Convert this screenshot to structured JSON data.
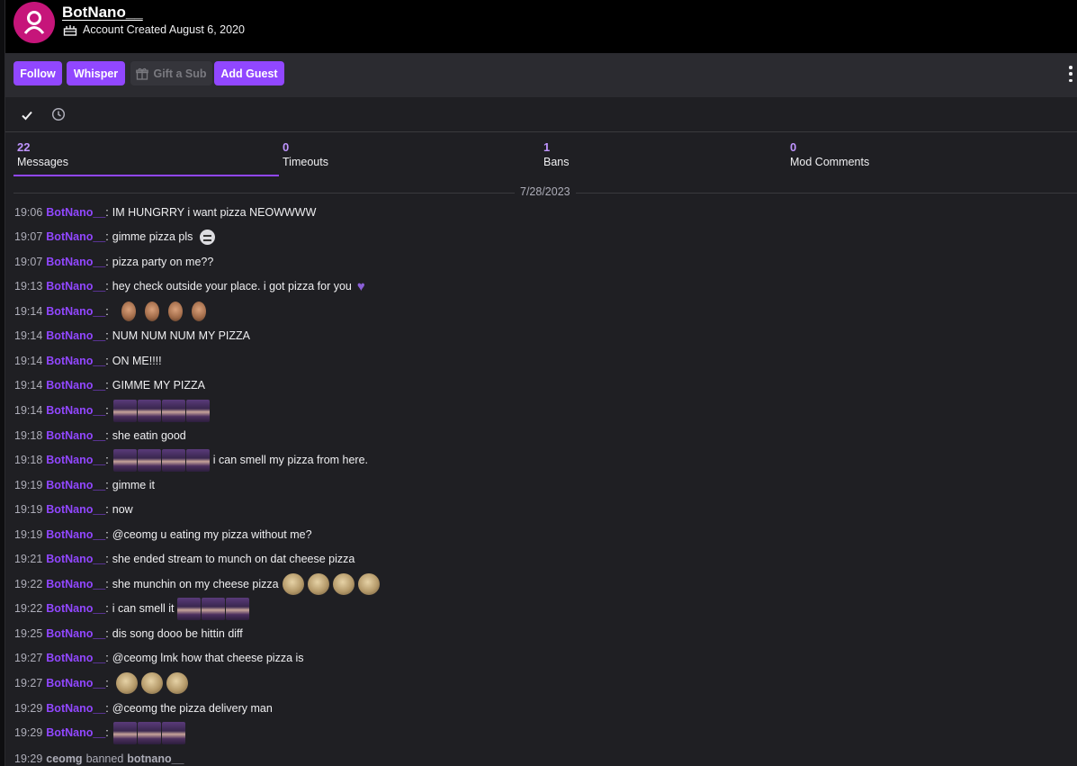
{
  "header": {
    "username": "BotNano__",
    "account_created": "Account Created August 6, 2020"
  },
  "actions": {
    "follow": "Follow",
    "whisper": "Whisper",
    "gift_sub": "Gift a Sub",
    "add_guest": "Add Guest"
  },
  "stats": [
    {
      "count": "22",
      "label": "Messages"
    },
    {
      "count": "0",
      "label": "Timeouts"
    },
    {
      "count": "1",
      "label": "Bans"
    },
    {
      "count": "0",
      "label": "Mod Comments"
    }
  ],
  "date": "7/28/2023",
  "messages": [
    {
      "time": "19:06",
      "user": "BotNano__",
      "text": "IM HUNGRRY i want pizza NEOWWWW"
    },
    {
      "time": "19:07",
      "user": "BotNano__",
      "text": "gimme pizza pls"
    },
    {
      "time": "19:07",
      "user": "BotNano__",
      "text": "pizza party on me??"
    },
    {
      "time": "19:13",
      "user": "BotNano__",
      "text": "hey check outside your place. i got pizza for you"
    },
    {
      "time": "19:14",
      "user": "BotNano__",
      "text": ""
    },
    {
      "time": "19:14",
      "user": "BotNano__",
      "text": "NUM NUM NUM MY PIZZA"
    },
    {
      "time": "19:14",
      "user": "BotNano__",
      "text": "ON ME!!!!"
    },
    {
      "time": "19:14",
      "user": "BotNano__",
      "text": "GIMME MY PIZZA"
    },
    {
      "time": "19:14",
      "user": "BotNano__",
      "text": ""
    },
    {
      "time": "19:18",
      "user": "BotNano__",
      "text": "she eatin good"
    },
    {
      "time": "19:18",
      "user": "BotNano__",
      "text": "i can smell my pizza from here."
    },
    {
      "time": "19:19",
      "user": "BotNano__",
      "text": "gimme it"
    },
    {
      "time": "19:19",
      "user": "BotNano__",
      "text": "now"
    },
    {
      "time": "19:19",
      "user": "BotNano__",
      "text": "@ceomg u eating my pizza without me?"
    },
    {
      "time": "19:21",
      "user": "BotNano__",
      "text": "she ended stream to munch on dat cheese pizza"
    },
    {
      "time": "19:22",
      "user": "BotNano__",
      "text": "she munchin on my cheese pizza"
    },
    {
      "time": "19:22",
      "user": "BotNano__",
      "text": "i can smell it"
    },
    {
      "time": "19:25",
      "user": "BotNano__",
      "text": "dis song dooo be hittin diff"
    },
    {
      "time": "19:27",
      "user": "BotNano__",
      "text": "@ceomg lmk how that cheese pizza is"
    },
    {
      "time": "19:27",
      "user": "BotNano__",
      "text": ""
    },
    {
      "time": "19:29",
      "user": "BotNano__",
      "text": "@ceomg the pizza delivery man"
    },
    {
      "time": "19:29",
      "user": "BotNano__",
      "text": ""
    }
  ],
  "ban_event": {
    "time": "19:29",
    "moderator": "ceomg",
    "action": "banned",
    "target": "botnano__"
  },
  "colors": {
    "accent": "#9147ff",
    "avatar": "#c6157a",
    "count": "#bf94ff"
  },
  "icons": {
    "avatar": "user-icon",
    "created": "cake-icon",
    "gift": "gift-icon",
    "filter_all": "check-icon",
    "filter_recent": "clock-icon",
    "more": "more-vertical-icon"
  }
}
